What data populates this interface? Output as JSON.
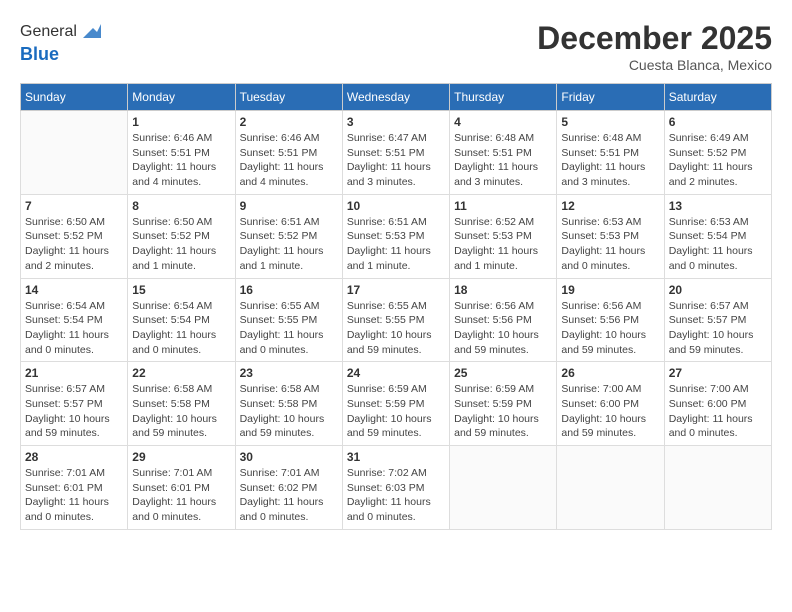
{
  "header": {
    "logo_line1": "General",
    "logo_line2": "Blue",
    "month_title": "December 2025",
    "location": "Cuesta Blanca, Mexico"
  },
  "weekdays": [
    "Sunday",
    "Monday",
    "Tuesday",
    "Wednesday",
    "Thursday",
    "Friday",
    "Saturday"
  ],
  "weeks": [
    [
      {
        "day": "",
        "info": ""
      },
      {
        "day": "1",
        "info": "Sunrise: 6:46 AM\nSunset: 5:51 PM\nDaylight: 11 hours\nand 4 minutes."
      },
      {
        "day": "2",
        "info": "Sunrise: 6:46 AM\nSunset: 5:51 PM\nDaylight: 11 hours\nand 4 minutes."
      },
      {
        "day": "3",
        "info": "Sunrise: 6:47 AM\nSunset: 5:51 PM\nDaylight: 11 hours\nand 3 minutes."
      },
      {
        "day": "4",
        "info": "Sunrise: 6:48 AM\nSunset: 5:51 PM\nDaylight: 11 hours\nand 3 minutes."
      },
      {
        "day": "5",
        "info": "Sunrise: 6:48 AM\nSunset: 5:51 PM\nDaylight: 11 hours\nand 3 minutes."
      },
      {
        "day": "6",
        "info": "Sunrise: 6:49 AM\nSunset: 5:52 PM\nDaylight: 11 hours\nand 2 minutes."
      }
    ],
    [
      {
        "day": "7",
        "info": "Sunrise: 6:50 AM\nSunset: 5:52 PM\nDaylight: 11 hours\nand 2 minutes."
      },
      {
        "day": "8",
        "info": "Sunrise: 6:50 AM\nSunset: 5:52 PM\nDaylight: 11 hours\nand 1 minute."
      },
      {
        "day": "9",
        "info": "Sunrise: 6:51 AM\nSunset: 5:52 PM\nDaylight: 11 hours\nand 1 minute."
      },
      {
        "day": "10",
        "info": "Sunrise: 6:51 AM\nSunset: 5:53 PM\nDaylight: 11 hours\nand 1 minute."
      },
      {
        "day": "11",
        "info": "Sunrise: 6:52 AM\nSunset: 5:53 PM\nDaylight: 11 hours\nand 1 minute."
      },
      {
        "day": "12",
        "info": "Sunrise: 6:53 AM\nSunset: 5:53 PM\nDaylight: 11 hours\nand 0 minutes."
      },
      {
        "day": "13",
        "info": "Sunrise: 6:53 AM\nSunset: 5:54 PM\nDaylight: 11 hours\nand 0 minutes."
      }
    ],
    [
      {
        "day": "14",
        "info": "Sunrise: 6:54 AM\nSunset: 5:54 PM\nDaylight: 11 hours\nand 0 minutes."
      },
      {
        "day": "15",
        "info": "Sunrise: 6:54 AM\nSunset: 5:54 PM\nDaylight: 11 hours\nand 0 minutes."
      },
      {
        "day": "16",
        "info": "Sunrise: 6:55 AM\nSunset: 5:55 PM\nDaylight: 11 hours\nand 0 minutes."
      },
      {
        "day": "17",
        "info": "Sunrise: 6:55 AM\nSunset: 5:55 PM\nDaylight: 10 hours\nand 59 minutes."
      },
      {
        "day": "18",
        "info": "Sunrise: 6:56 AM\nSunset: 5:56 PM\nDaylight: 10 hours\nand 59 minutes."
      },
      {
        "day": "19",
        "info": "Sunrise: 6:56 AM\nSunset: 5:56 PM\nDaylight: 10 hours\nand 59 minutes."
      },
      {
        "day": "20",
        "info": "Sunrise: 6:57 AM\nSunset: 5:57 PM\nDaylight: 10 hours\nand 59 minutes."
      }
    ],
    [
      {
        "day": "21",
        "info": "Sunrise: 6:57 AM\nSunset: 5:57 PM\nDaylight: 10 hours\nand 59 minutes."
      },
      {
        "day": "22",
        "info": "Sunrise: 6:58 AM\nSunset: 5:58 PM\nDaylight: 10 hours\nand 59 minutes."
      },
      {
        "day": "23",
        "info": "Sunrise: 6:58 AM\nSunset: 5:58 PM\nDaylight: 10 hours\nand 59 minutes."
      },
      {
        "day": "24",
        "info": "Sunrise: 6:59 AM\nSunset: 5:59 PM\nDaylight: 10 hours\nand 59 minutes."
      },
      {
        "day": "25",
        "info": "Sunrise: 6:59 AM\nSunset: 5:59 PM\nDaylight: 10 hours\nand 59 minutes."
      },
      {
        "day": "26",
        "info": "Sunrise: 7:00 AM\nSunset: 6:00 PM\nDaylight: 10 hours\nand 59 minutes."
      },
      {
        "day": "27",
        "info": "Sunrise: 7:00 AM\nSunset: 6:00 PM\nDaylight: 11 hours\nand 0 minutes."
      }
    ],
    [
      {
        "day": "28",
        "info": "Sunrise: 7:01 AM\nSunset: 6:01 PM\nDaylight: 11 hours\nand 0 minutes."
      },
      {
        "day": "29",
        "info": "Sunrise: 7:01 AM\nSunset: 6:01 PM\nDaylight: 11 hours\nand 0 minutes."
      },
      {
        "day": "30",
        "info": "Sunrise: 7:01 AM\nSunset: 6:02 PM\nDaylight: 11 hours\nand 0 minutes."
      },
      {
        "day": "31",
        "info": "Sunrise: 7:02 AM\nSunset: 6:03 PM\nDaylight: 11 hours\nand 0 minutes."
      },
      {
        "day": "",
        "info": ""
      },
      {
        "day": "",
        "info": ""
      },
      {
        "day": "",
        "info": ""
      }
    ]
  ]
}
